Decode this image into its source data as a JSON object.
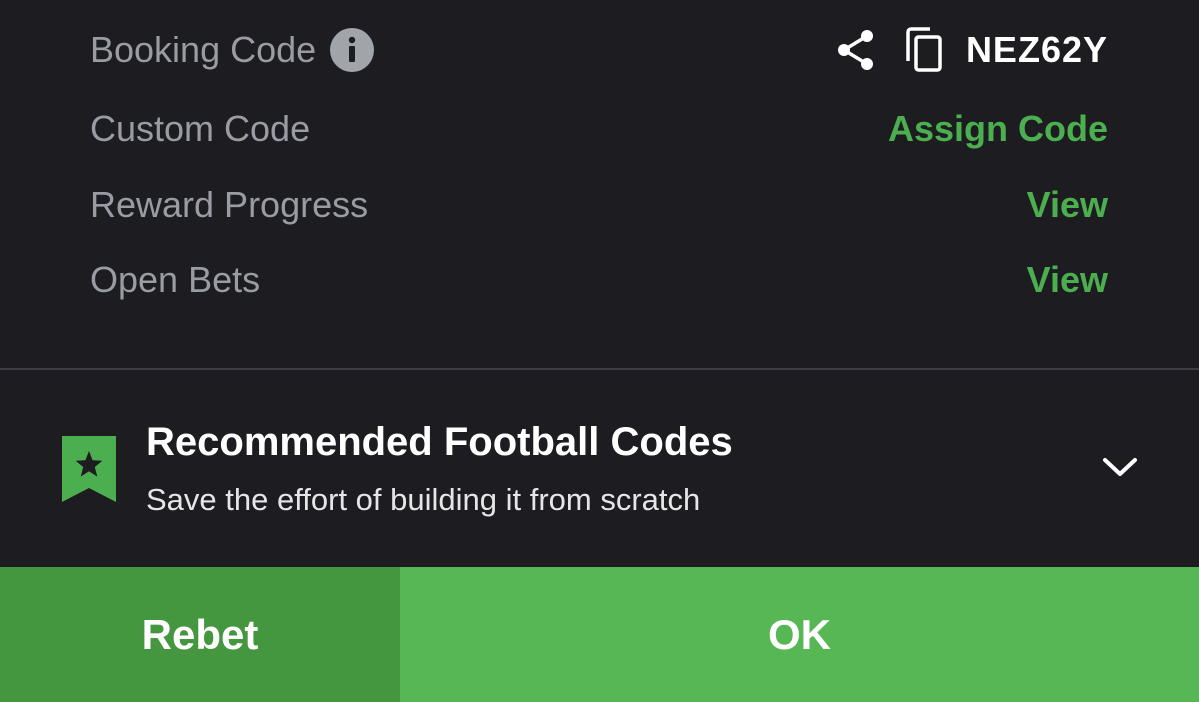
{
  "details": {
    "booking_code": {
      "label": "Booking Code",
      "value": "NEZ62Y",
      "icons": [
        "info-icon",
        "share-icon",
        "copy-icon"
      ]
    },
    "custom_code": {
      "label": "Custom Code",
      "action": "Assign Code"
    },
    "reward_progress": {
      "label": "Reward Progress",
      "action": "View"
    },
    "open_bets": {
      "label": "Open Bets",
      "action": "View"
    }
  },
  "recommended": {
    "title": "Recommended Football Codes",
    "subtitle": "Save the effort of building it from scratch",
    "icons": [
      "bookmark-star-icon",
      "chevron-down-icon"
    ]
  },
  "footer": {
    "rebet_label": "Rebet",
    "ok_label": "OK"
  },
  "colors": {
    "background": "#1c1c21",
    "label_gray": "#9a9ca4",
    "accent_green": "#4caf4f",
    "rebet_green": "#44963f",
    "ok_green": "#57b755",
    "divider": "#3d3e45"
  }
}
